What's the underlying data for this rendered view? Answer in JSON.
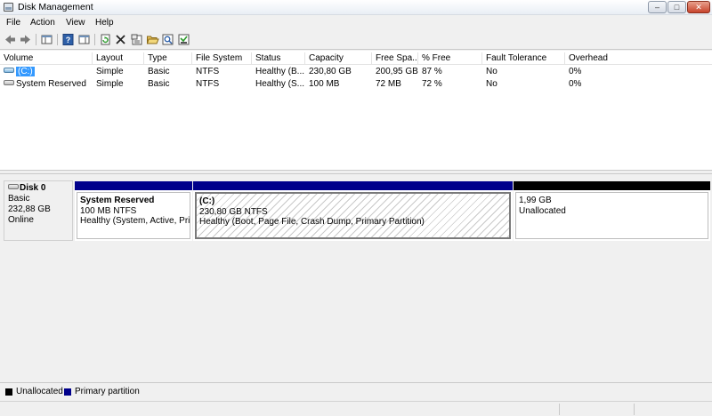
{
  "window": {
    "title": "Disk Management",
    "minimize_symbol": "–",
    "maximize_symbol": "□",
    "close_symbol": "✕"
  },
  "menu": [
    "File",
    "Action",
    "View",
    "Help"
  ],
  "toolbar": {
    "icons": [
      "back-arrow-icon",
      "forward-arrow-icon",
      "show-hide-console-tree-icon",
      "help-icon",
      "properties-list-icon",
      "refresh-icon",
      "delete-icon",
      "properties-icon",
      "open-folder-icon",
      "explore-icon",
      "rescan-disks-icon"
    ]
  },
  "volume_list": {
    "columns": [
      "Volume",
      "Layout",
      "Type",
      "File System",
      "Status",
      "Capacity",
      "Free Spa...",
      "% Free",
      "Fault Tolerance",
      "Overhead"
    ],
    "rows": [
      {
        "volume": "(C:)",
        "layout": "Simple",
        "type": "Basic",
        "file_system": "NTFS",
        "status": "Healthy (B...",
        "capacity": "230,80 GB",
        "free_space": "200,95 GB",
        "percent_free": "87 %",
        "fault_tolerance": "No",
        "overhead": "0%",
        "selected": true
      },
      {
        "volume": "System Reserved",
        "layout": "Simple",
        "type": "Basic",
        "file_system": "NTFS",
        "status": "Healthy (S...",
        "capacity": "100 MB",
        "free_space": "72 MB",
        "percent_free": "72 %",
        "fault_tolerance": "No",
        "overhead": "0%",
        "selected": false
      }
    ]
  },
  "disk": {
    "name": "Disk 0",
    "type": "Basic",
    "size": "232,88 GB",
    "state": "Online",
    "partitions": [
      {
        "name": "System Reserved",
        "size_fs": "100 MB NTFS",
        "status": "Healthy (System, Active, Prim",
        "kind": "primary"
      },
      {
        "name": "(C:)",
        "size_fs": "230,80 GB NTFS",
        "status": "Healthy (Boot, Page File, Crash Dump, Primary Partition)",
        "kind": "primary"
      },
      {
        "name": "",
        "size_fs": "1,99 GB",
        "status": "Unallocated",
        "kind": "unallocated"
      }
    ]
  },
  "legend": {
    "items": [
      {
        "label": "Unallocated",
        "color": "#000000"
      },
      {
        "label": "Primary partition",
        "color": "#00008b"
      }
    ]
  },
  "colors": {
    "primary_partition": "#00008b",
    "unallocated": "#000000",
    "selection": "#3399ff"
  }
}
